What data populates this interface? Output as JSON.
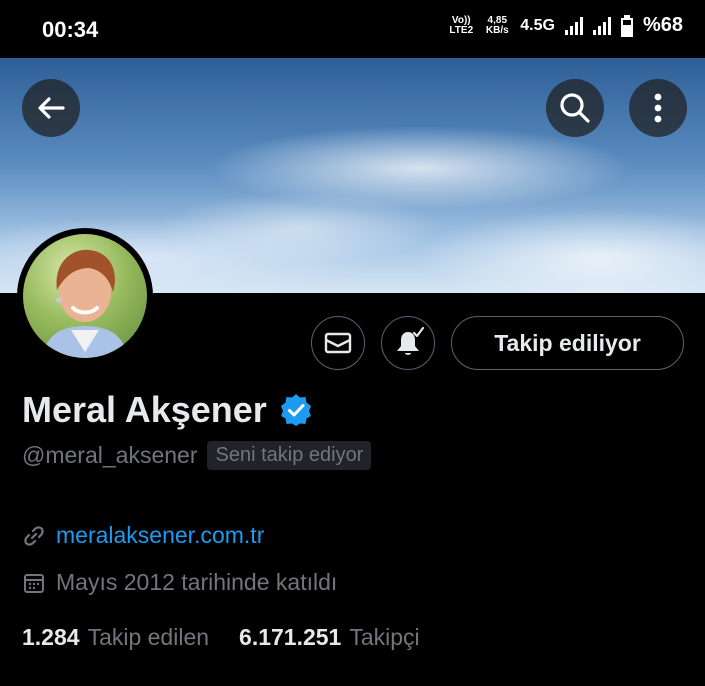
{
  "status_bar": {
    "time": "00:34",
    "volte_top": "Vo))",
    "volte_bottom": "LTE2",
    "speed_value": "4,85",
    "speed_unit": "KB/s",
    "network": "4.5G",
    "battery": "%68",
    "battery_level": 0.68
  },
  "header": {
    "back_icon": "arrow-left-icon",
    "search_icon": "search-icon",
    "more_icon": "more-vertical-icon"
  },
  "actions": {
    "message_icon": "envelope-icon",
    "notify_icon": "bell-check-icon",
    "follow_label": "Takip ediliyor"
  },
  "profile": {
    "name": "Meral Akşener",
    "verified": true,
    "handle": "@meral_aksener",
    "follows_you": "Seni takip ediyor",
    "website": "meralaksener.com.tr",
    "joined": "Mayıs 2012 tarihinde katıldı"
  },
  "stats": {
    "following_count": "1.284",
    "following_label": "Takip edilen",
    "followers_count": "6.171.251",
    "followers_label": "Takipçi"
  },
  "colors": {
    "link": "#1d9bf0",
    "verified": "#1d9bf0",
    "muted": "#71767b"
  }
}
